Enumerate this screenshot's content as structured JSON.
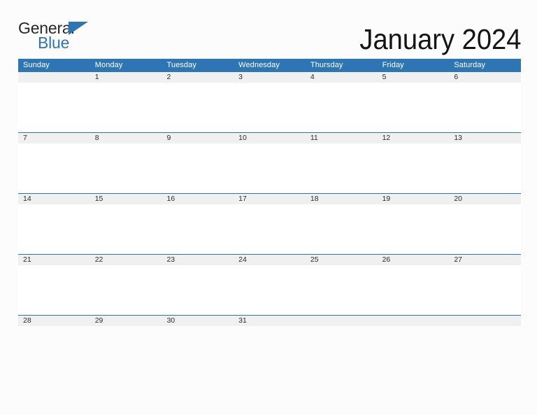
{
  "brand": {
    "name_part1": "General",
    "name_part2": "Blue",
    "triangle_icon": "triangle-icon",
    "color_dark": "#262626",
    "color_blue": "#2e75b6"
  },
  "header": {
    "title": "January 2024"
  },
  "colors": {
    "header_blue": "#2e75b6",
    "row_divider_blue": "#2e75b6",
    "date_band_gray": "#f0f0f0",
    "page_background": "#fcfcfc",
    "date_text": "#2b2b2b",
    "weekday_text": "#ffffff"
  },
  "calendar": {
    "month": "January",
    "year": "2024",
    "weekdays": [
      "Sunday",
      "Monday",
      "Tuesday",
      "Wednesday",
      "Thursday",
      "Friday",
      "Saturday"
    ],
    "weeks": [
      [
        "",
        "1",
        "2",
        "3",
        "4",
        "5",
        "6"
      ],
      [
        "7",
        "8",
        "9",
        "10",
        "11",
        "12",
        "13"
      ],
      [
        "14",
        "15",
        "16",
        "17",
        "18",
        "19",
        "20"
      ],
      [
        "21",
        "22",
        "23",
        "24",
        "25",
        "26",
        "27"
      ],
      [
        "28",
        "29",
        "30",
        "31",
        "",
        "",
        ""
      ]
    ]
  }
}
